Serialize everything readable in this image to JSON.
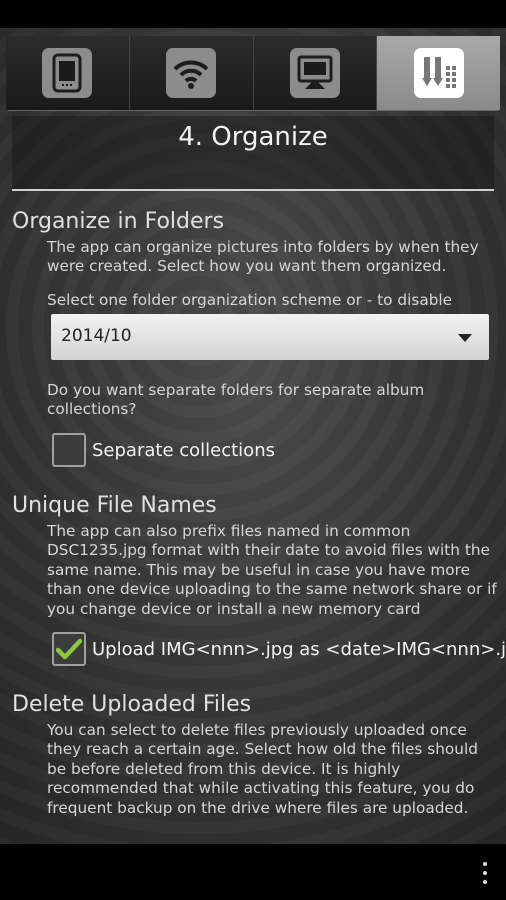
{
  "tabs": [
    {
      "icon": "tablet-icon",
      "active": false
    },
    {
      "icon": "wifi-icon",
      "active": false
    },
    {
      "icon": "upload-to-screen-icon",
      "active": false
    },
    {
      "icon": "organize-icon",
      "active": true
    }
  ],
  "page_title": "4. Organize",
  "organize_folders": {
    "heading": "Organize in Folders",
    "description": "The app can organize pictures into folders by when they were created. Select how you want them organized.",
    "select_prompt": "Select one folder organization scheme or - to disable",
    "select_value": "2014/10",
    "separate_question": "Do you want separate folders for separate album collections?",
    "separate_label": "Separate collections",
    "separate_checked": false
  },
  "unique_names": {
    "heading": "Unique File Names",
    "description": "The app can also prefix files named in common DSC1235.jpg format with their date to avoid files with the same name. This may be useful in case you have more than one device uploading to the same network share or if you change device or install a new memory card",
    "upload_label": "Upload IMG<nnn>.jpg as <date>IMG<nnn>.jpg",
    "upload_checked": true
  },
  "delete_uploaded": {
    "heading": "Delete Uploaded Files",
    "description": "You can select to delete files previously uploaded once they reach a certain age. Select how old the files should be before deleted from this device. It is highly recommended that while activating this feature, you do frequent backup on the drive where files are uploaded."
  },
  "colors": {
    "accent_check": "#8dc63f",
    "active_tab": "#9a9a9a"
  }
}
